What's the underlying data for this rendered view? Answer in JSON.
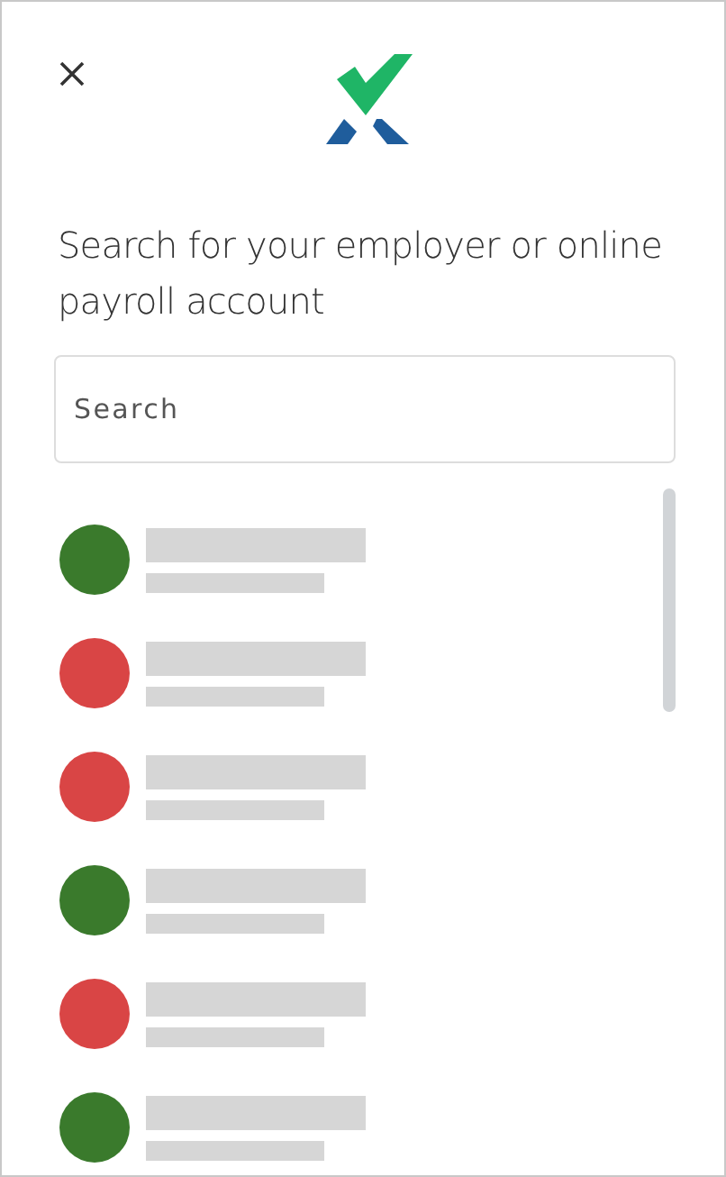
{
  "heading": "Search for your employer or online payroll account",
  "search": {
    "placeholder": "Search"
  },
  "results": [
    {
      "color": "#3a7a2c"
    },
    {
      "color": "#d94545"
    },
    {
      "color": "#d94545"
    },
    {
      "color": "#3a7a2c"
    },
    {
      "color": "#d94545"
    },
    {
      "color": "#3a7a2c"
    }
  ]
}
